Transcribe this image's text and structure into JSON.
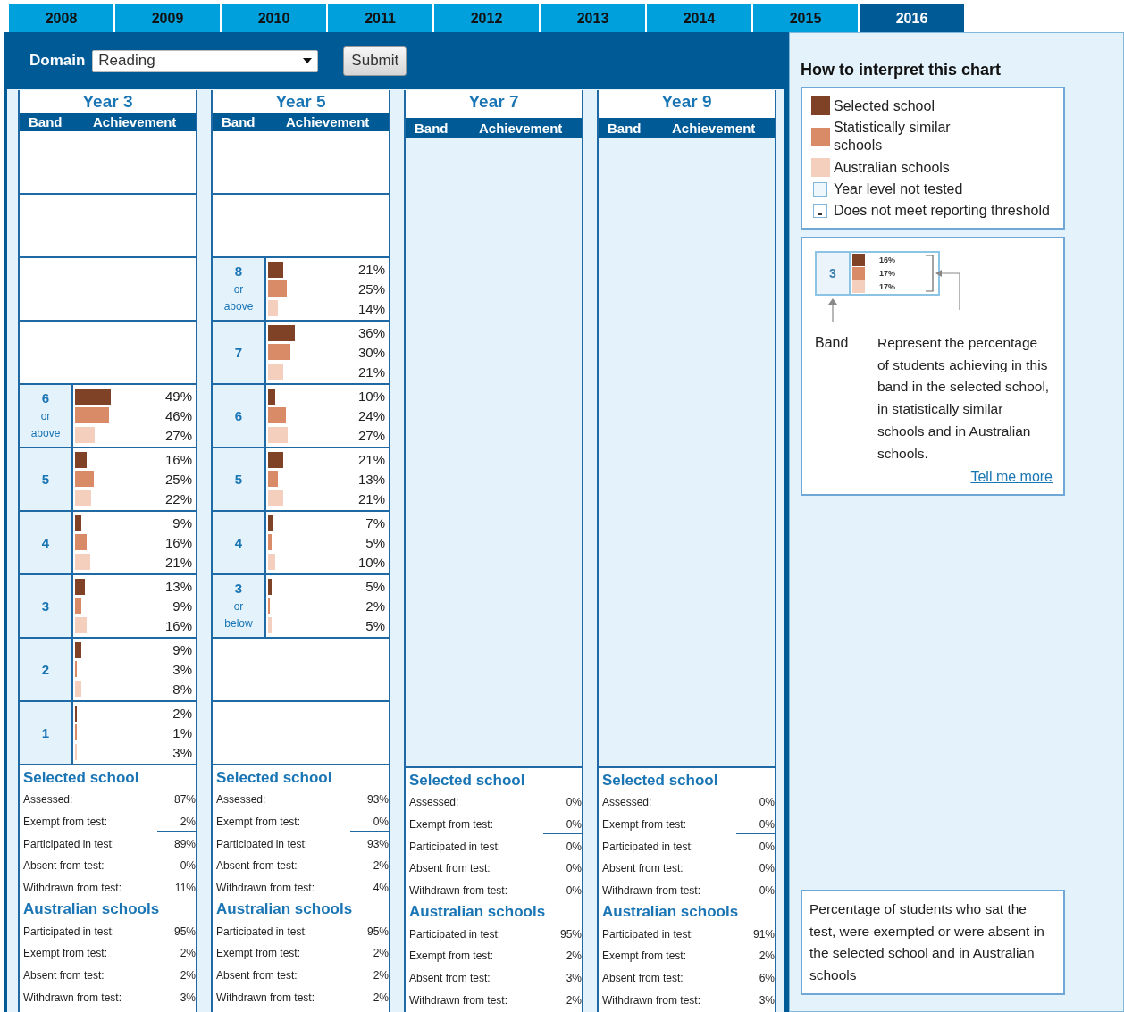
{
  "year_tabs": [
    {
      "label": "2008",
      "selected": false
    },
    {
      "label": "2009",
      "selected": false
    },
    {
      "label": "2010",
      "selected": false
    },
    {
      "label": "2011",
      "selected": false
    },
    {
      "label": "2012",
      "selected": false
    },
    {
      "label": "2013",
      "selected": false
    },
    {
      "label": "2014",
      "selected": false
    },
    {
      "label": "2015",
      "selected": false
    },
    {
      "label": "2016",
      "selected": true
    }
  ],
  "domain": {
    "label": "Domain",
    "value": "Reading"
  },
  "submit_button": "Submit",
  "year_levels": [
    {
      "title": "Year 3",
      "tested": true,
      "columns": [
        "Band",
        "Achievement"
      ],
      "bands": [
        {
          "kind": "empty"
        },
        {
          "kind": "empty"
        },
        {
          "kind": "empty"
        },
        {
          "kind": "empty"
        },
        {
          "kind": "band",
          "band": "6",
          "qualifier": "or above",
          "values": [
            "49%",
            "46%",
            "27%"
          ]
        },
        {
          "kind": "band",
          "band": "5",
          "values": [
            "16%",
            "25%",
            "22%"
          ]
        },
        {
          "kind": "band",
          "band": "4",
          "values": [
            "9%",
            "16%",
            "21%"
          ]
        },
        {
          "kind": "band",
          "band": "3",
          "values": [
            "13%",
            "9%",
            "16%"
          ]
        },
        {
          "kind": "band",
          "band": "2",
          "values": [
            "9%",
            "3%",
            "8%"
          ]
        },
        {
          "kind": "band",
          "band": "1",
          "values": [
            "2%",
            "1%",
            "3%"
          ]
        }
      ],
      "selected_school": {
        "heading": "Selected school",
        "rows": [
          {
            "label": "Assessed:",
            "value": "87%",
            "underlined": false
          },
          {
            "label": "Exempt from test:",
            "value": "2%",
            "underlined": true
          },
          {
            "label": "Participated in test:",
            "value": "89%",
            "underlined": false
          },
          {
            "label": "Absent from test:",
            "value": "0%",
            "underlined": false
          },
          {
            "label": "Withdrawn from test:",
            "value": "11%",
            "underlined": false
          }
        ]
      },
      "australian_schools": {
        "heading": "Australian schools",
        "rows": [
          {
            "label": "Participated in test:",
            "value": "95%"
          },
          {
            "label": "Exempt from test:",
            "value": "2%"
          },
          {
            "label": "Absent from test:",
            "value": "2%"
          },
          {
            "label": "Withdrawn from test:",
            "value": "3%"
          }
        ]
      }
    },
    {
      "title": "Year 5",
      "tested": true,
      "columns": [
        "Band",
        "Achievement"
      ],
      "bands": [
        {
          "kind": "empty"
        },
        {
          "kind": "empty"
        },
        {
          "kind": "band",
          "band": "8",
          "qualifier": "or above",
          "values": [
            "21%",
            "25%",
            "14%"
          ]
        },
        {
          "kind": "band",
          "band": "7",
          "values": [
            "36%",
            "30%",
            "21%"
          ]
        },
        {
          "kind": "band",
          "band": "6",
          "values": [
            "10%",
            "24%",
            "27%"
          ]
        },
        {
          "kind": "band",
          "band": "5",
          "values": [
            "21%",
            "13%",
            "21%"
          ]
        },
        {
          "kind": "band",
          "band": "4",
          "values": [
            "7%",
            "5%",
            "10%"
          ]
        },
        {
          "kind": "band",
          "band": "3",
          "qualifier": "or below",
          "values": [
            "5%",
            "2%",
            "5%"
          ]
        },
        {
          "kind": "empty"
        },
        {
          "kind": "empty"
        }
      ],
      "selected_school": {
        "heading": "Selected school",
        "rows": [
          {
            "label": "Assessed:",
            "value": "93%",
            "underlined": false
          },
          {
            "label": "Exempt from test:",
            "value": "0%",
            "underlined": true
          },
          {
            "label": "Participated in test:",
            "value": "93%",
            "underlined": false
          },
          {
            "label": "Absent from test:",
            "value": "2%",
            "underlined": false
          },
          {
            "label": "Withdrawn from test:",
            "value": "4%",
            "underlined": false
          }
        ]
      },
      "australian_schools": {
        "heading": "Australian schools",
        "rows": [
          {
            "label": "Participated in test:",
            "value": "95%"
          },
          {
            "label": "Exempt from test:",
            "value": "2%"
          },
          {
            "label": "Absent from test:",
            "value": "2%"
          },
          {
            "label": "Withdrawn from test:",
            "value": "2%"
          }
        ]
      }
    },
    {
      "title": "Year 7",
      "tested": false,
      "columns": [
        "Band",
        "Achievement"
      ],
      "selected_school": {
        "heading": "Selected school",
        "rows": [
          {
            "label": "Assessed:",
            "value": "0%",
            "underlined": false
          },
          {
            "label": "Exempt from test:",
            "value": "0%",
            "underlined": true
          },
          {
            "label": "Participated in test:",
            "value": "0%",
            "underlined": false
          },
          {
            "label": "Absent from test:",
            "value": "0%",
            "underlined": false
          },
          {
            "label": "Withdrawn from test:",
            "value": "0%",
            "underlined": false
          }
        ]
      },
      "australian_schools": {
        "heading": "Australian schools",
        "rows": [
          {
            "label": "Participated in test:",
            "value": "95%"
          },
          {
            "label": "Exempt from test:",
            "value": "2%"
          },
          {
            "label": "Absent from test:",
            "value": "3%"
          },
          {
            "label": "Withdrawn from test:",
            "value": "2%"
          }
        ]
      }
    },
    {
      "title": "Year 9",
      "tested": false,
      "columns": [
        "Band",
        "Achievement"
      ],
      "selected_school": {
        "heading": "Selected school",
        "rows": [
          {
            "label": "Assessed:",
            "value": "0%",
            "underlined": false
          },
          {
            "label": "Exempt from test:",
            "value": "0%",
            "underlined": true
          },
          {
            "label": "Participated in test:",
            "value": "0%",
            "underlined": false
          },
          {
            "label": "Absent from test:",
            "value": "0%",
            "underlined": false
          },
          {
            "label": "Withdrawn from test:",
            "value": "0%",
            "underlined": false
          }
        ]
      },
      "australian_schools": {
        "heading": "Australian schools",
        "rows": [
          {
            "label": "Participated in test:",
            "value": "91%"
          },
          {
            "label": "Exempt from test:",
            "value": "2%"
          },
          {
            "label": "Absent from test:",
            "value": "6%"
          },
          {
            "label": "Withdrawn from test:",
            "value": "3%"
          }
        ]
      }
    }
  ],
  "interpretation": {
    "title": "How to interpret this chart",
    "legend": [
      {
        "kind": "swatch",
        "label": "Selected school",
        "color": "#7f4226"
      },
      {
        "kind": "swatch",
        "label": "Statistically similar schools",
        "color": "#d98b67"
      },
      {
        "kind": "swatch",
        "label": "Australian schools",
        "color": "#f4cfbd"
      },
      {
        "kind": "not-tested",
        "label": "Year level not tested"
      },
      {
        "kind": "threshold",
        "label": "Does not meet reporting threshold"
      }
    ],
    "example": {
      "band": "3",
      "values": [
        "16%",
        "17%",
        "17%"
      ]
    },
    "band_label": "Band",
    "description": "Represent the percentage of students achieving in this band in the selected school, in statistically similar schools and in Australian schools.",
    "link": "Tell me more"
  },
  "participation_note": "Percentage of students who sat the test, were exempted or were absent in the selected school and in Australian schools"
}
